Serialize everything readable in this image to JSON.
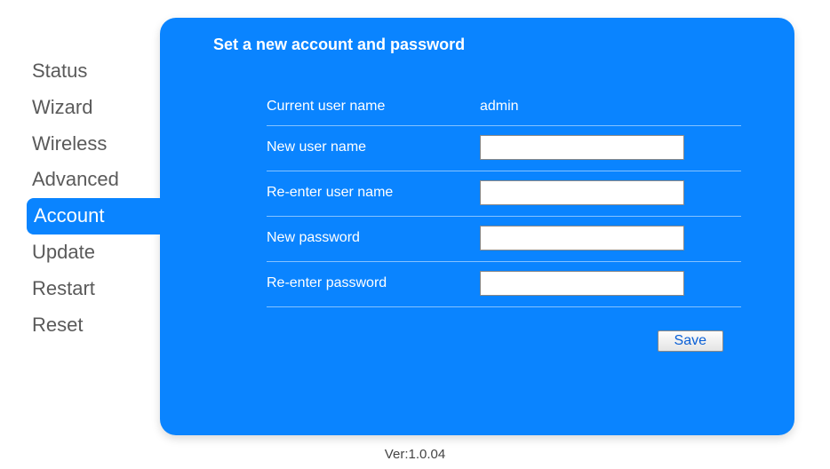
{
  "sidebar": {
    "items": [
      {
        "label": "Status"
      },
      {
        "label": "Wizard"
      },
      {
        "label": "Wireless"
      },
      {
        "label": "Advanced"
      },
      {
        "label": "Account"
      },
      {
        "label": "Update"
      },
      {
        "label": "Restart"
      },
      {
        "label": "Reset"
      }
    ],
    "active_index": 4
  },
  "panel": {
    "title": "Set a new account and password",
    "current_user_label": "Current user name",
    "current_user_value": "admin",
    "new_user_label": "New user name",
    "new_user_value": "",
    "reenter_user_label": "Re-enter user name",
    "reenter_user_value": "",
    "new_password_label": "New password",
    "new_password_value": "",
    "reenter_password_label": "Re-enter password",
    "reenter_password_value": "",
    "save_label": "Save"
  },
  "footer": {
    "version": "Ver:1.0.04"
  }
}
